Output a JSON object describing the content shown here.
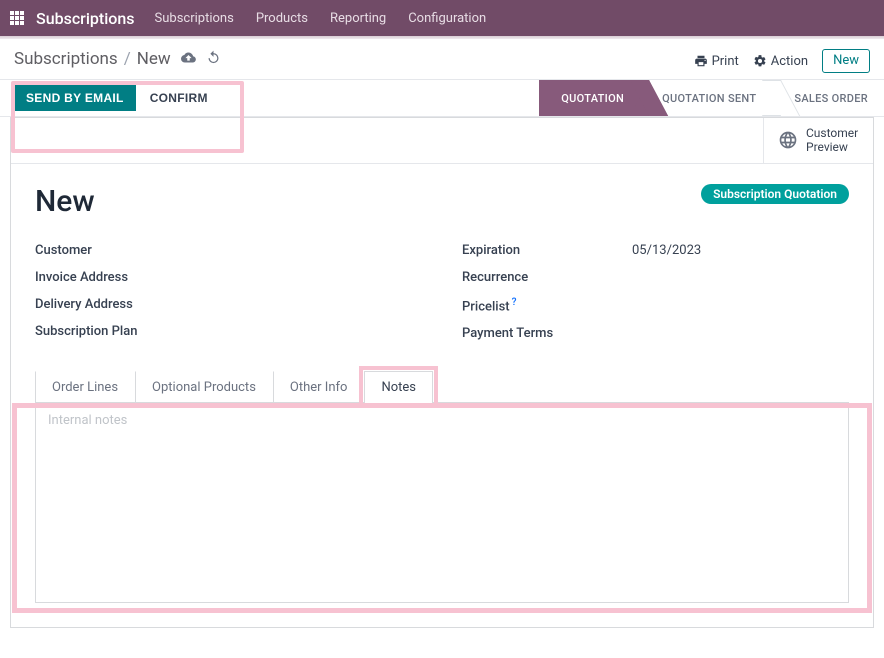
{
  "navbar": {
    "brand": "Subscriptions",
    "links": [
      "Subscriptions",
      "Products",
      "Reporting",
      "Configuration"
    ]
  },
  "breadcrumb": {
    "parent": "Subscriptions",
    "current": "New"
  },
  "controlPanel": {
    "print": "Print",
    "action": "Action",
    "newBtn": "New"
  },
  "statusbarButtons": {
    "sendEmail": "SEND BY EMAIL",
    "confirm": "CONFIRM"
  },
  "statusSteps": {
    "quotation": "QUOTATION",
    "quotationSent": "QUOTATION SENT",
    "salesOrder": "SALES ORDER"
  },
  "buttonBox": {
    "customerPreview1": "Customer",
    "customerPreview2": "Preview"
  },
  "form": {
    "title": "New",
    "badge": "Subscription Quotation",
    "left": {
      "customer": "Customer",
      "invoiceAddress": "Invoice Address",
      "deliveryAddress": "Delivery Address",
      "subscriptionPlan": "Subscription Plan"
    },
    "right": {
      "expiration": "Expiration",
      "expirationValue": "05/13/2023",
      "recurrence": "Recurrence",
      "pricelist": "Pricelist",
      "paymentTerms": "Payment Terms"
    }
  },
  "tabs": {
    "orderLines": "Order Lines",
    "optionalProducts": "Optional Products",
    "otherInfo": "Other Info",
    "notes": "Notes"
  },
  "notesPlaceholder": "Internal notes"
}
